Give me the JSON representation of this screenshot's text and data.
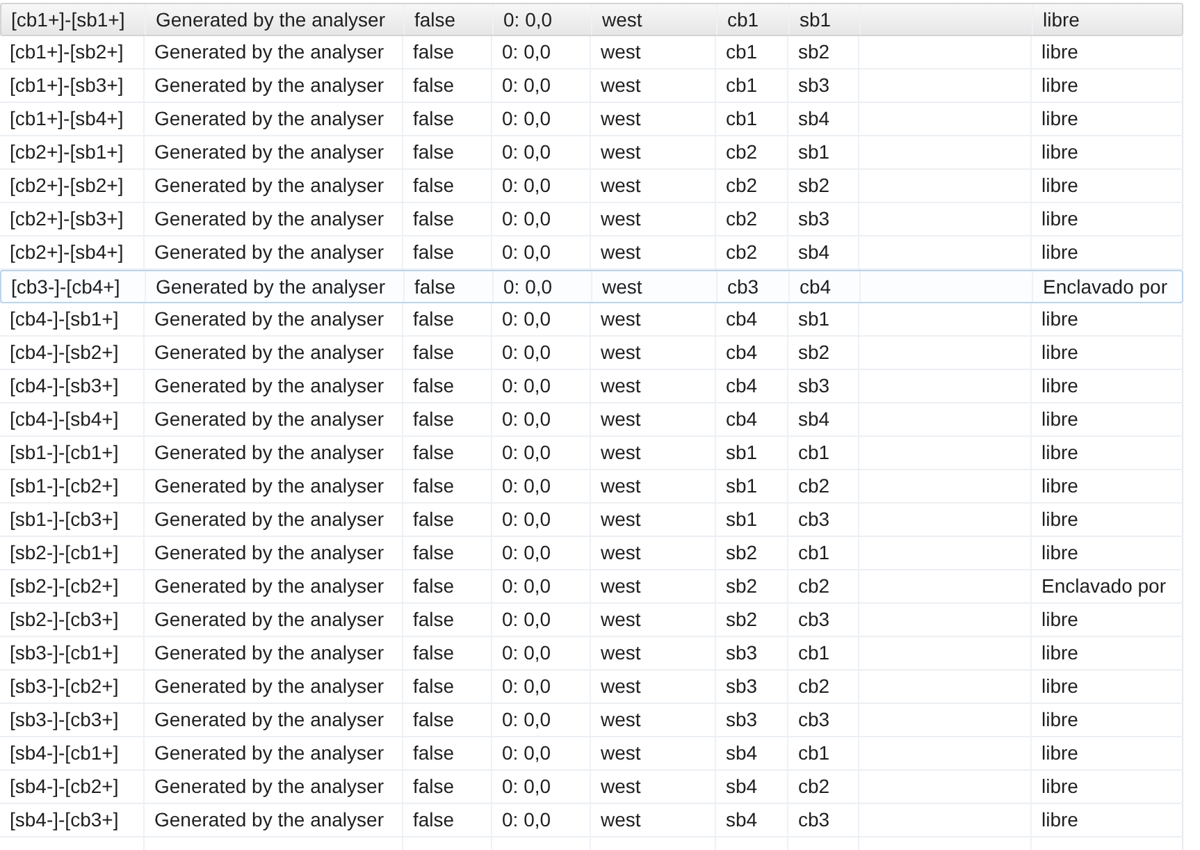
{
  "table": {
    "rows": [
      {
        "selected": true,
        "hovered": false,
        "cells": [
          "[cb1+]-[sb1+]",
          "Generated by the analyser",
          "false",
          "0: 0,0",
          "west",
          "cb1",
          "sb1",
          "libre"
        ]
      },
      {
        "selected": false,
        "hovered": false,
        "cells": [
          "[cb1+]-[sb2+]",
          "Generated by the analyser",
          "false",
          "0: 0,0",
          "west",
          "cb1",
          "sb2",
          "libre"
        ]
      },
      {
        "selected": false,
        "hovered": false,
        "cells": [
          "[cb1+]-[sb3+]",
          "Generated by the analyser",
          "false",
          "0: 0,0",
          "west",
          "cb1",
          "sb3",
          "libre"
        ]
      },
      {
        "selected": false,
        "hovered": false,
        "cells": [
          "[cb1+]-[sb4+]",
          "Generated by the analyser",
          "false",
          "0: 0,0",
          "west",
          "cb1",
          "sb4",
          "libre"
        ]
      },
      {
        "selected": false,
        "hovered": false,
        "cells": [
          "[cb2+]-[sb1+]",
          "Generated by the analyser",
          "false",
          "0: 0,0",
          "west",
          "cb2",
          "sb1",
          "libre"
        ]
      },
      {
        "selected": false,
        "hovered": false,
        "cells": [
          "[cb2+]-[sb2+]",
          "Generated by the analyser",
          "false",
          "0: 0,0",
          "west",
          "cb2",
          "sb2",
          "libre"
        ]
      },
      {
        "selected": false,
        "hovered": false,
        "cells": [
          "[cb2+]-[sb3+]",
          "Generated by the analyser",
          "false",
          "0: 0,0",
          "west",
          "cb2",
          "sb3",
          "libre"
        ]
      },
      {
        "selected": false,
        "hovered": false,
        "cells": [
          "[cb2+]-[sb4+]",
          "Generated by the analyser",
          "false",
          "0: 0,0",
          "west",
          "cb2",
          "sb4",
          "libre"
        ]
      },
      {
        "selected": false,
        "hovered": true,
        "cells": [
          "[cb3-]-[cb4+]",
          "Generated by the analyser",
          "false",
          "0: 0,0",
          "west",
          "cb3",
          "cb4",
          "Enclavado por"
        ]
      },
      {
        "selected": false,
        "hovered": false,
        "cells": [
          "[cb4-]-[sb1+]",
          "Generated by the analyser",
          "false",
          "0: 0,0",
          "west",
          "cb4",
          "sb1",
          "libre"
        ]
      },
      {
        "selected": false,
        "hovered": false,
        "cells": [
          "[cb4-]-[sb2+]",
          "Generated by the analyser",
          "false",
          "0: 0,0",
          "west",
          "cb4",
          "sb2",
          "libre"
        ]
      },
      {
        "selected": false,
        "hovered": false,
        "cells": [
          "[cb4-]-[sb3+]",
          "Generated by the analyser",
          "false",
          "0: 0,0",
          "west",
          "cb4",
          "sb3",
          "libre"
        ]
      },
      {
        "selected": false,
        "hovered": false,
        "cells": [
          "[cb4-]-[sb4+]",
          "Generated by the analyser",
          "false",
          "0: 0,0",
          "west",
          "cb4",
          "sb4",
          "libre"
        ]
      },
      {
        "selected": false,
        "hovered": false,
        "cells": [
          "[sb1-]-[cb1+]",
          "Generated by the analyser",
          "false",
          "0: 0,0",
          "west",
          "sb1",
          "cb1",
          "libre"
        ]
      },
      {
        "selected": false,
        "hovered": false,
        "cells": [
          "[sb1-]-[cb2+]",
          "Generated by the analyser",
          "false",
          "0: 0,0",
          "west",
          "sb1",
          "cb2",
          "libre"
        ]
      },
      {
        "selected": false,
        "hovered": false,
        "cells": [
          "[sb1-]-[cb3+]",
          "Generated by the analyser",
          "false",
          "0: 0,0",
          "west",
          "sb1",
          "cb3",
          "libre"
        ]
      },
      {
        "selected": false,
        "hovered": false,
        "cells": [
          "[sb2-]-[cb1+]",
          "Generated by the analyser",
          "false",
          "0: 0,0",
          "west",
          "sb2",
          "cb1",
          "libre"
        ]
      },
      {
        "selected": false,
        "hovered": false,
        "cells": [
          "[sb2-]-[cb2+]",
          "Generated by the analyser",
          "false",
          "0: 0,0",
          "west",
          "sb2",
          "cb2",
          "Enclavado por"
        ]
      },
      {
        "selected": false,
        "hovered": false,
        "cells": [
          "[sb2-]-[cb3+]",
          "Generated by the analyser",
          "false",
          "0: 0,0",
          "west",
          "sb2",
          "cb3",
          "libre"
        ]
      },
      {
        "selected": false,
        "hovered": false,
        "cells": [
          "[sb3-]-[cb1+]",
          "Generated by the analyser",
          "false",
          "0: 0,0",
          "west",
          "sb3",
          "cb1",
          "libre"
        ]
      },
      {
        "selected": false,
        "hovered": false,
        "cells": [
          "[sb3-]-[cb2+]",
          "Generated by the analyser",
          "false",
          "0: 0,0",
          "west",
          "sb3",
          "cb2",
          "libre"
        ]
      },
      {
        "selected": false,
        "hovered": false,
        "cells": [
          "[sb3-]-[cb3+]",
          "Generated by the analyser",
          "false",
          "0: 0,0",
          "west",
          "sb3",
          "cb3",
          "libre"
        ]
      },
      {
        "selected": false,
        "hovered": false,
        "cells": [
          "[sb4-]-[cb1+]",
          "Generated by the analyser",
          "false",
          "0: 0,0",
          "west",
          "sb4",
          "cb1",
          "libre"
        ]
      },
      {
        "selected": false,
        "hovered": false,
        "cells": [
          "[sb4-]-[cb2+]",
          "Generated by the analyser",
          "false",
          "0: 0,0",
          "west",
          "sb4",
          "cb2",
          "libre"
        ]
      },
      {
        "selected": false,
        "hovered": false,
        "cells": [
          "[sb4-]-[cb3+]",
          "Generated by the analyser",
          "false",
          "0: 0,0",
          "west",
          "sb4",
          "cb3",
          "libre"
        ]
      }
    ]
  }
}
